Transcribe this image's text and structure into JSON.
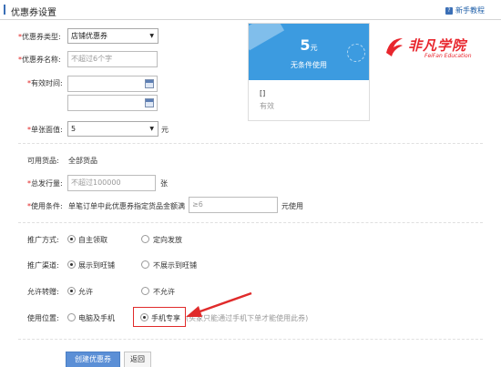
{
  "header": {
    "title": "优惠券设置",
    "help_label": "新手教程"
  },
  "form": {
    "type": {
      "label": "优惠券类型:",
      "value": "店铺优惠券"
    },
    "name": {
      "label": "优惠券名称:",
      "placeholder": "不超过6个字"
    },
    "period": {
      "label": "有效时间:"
    },
    "face_value": {
      "label": "单张面值:",
      "value": "5",
      "unit": "元"
    },
    "goods": {
      "label": "可用货品:",
      "value": "全部货品"
    },
    "quantity": {
      "label": "总发行量:",
      "placeholder": "不超过100000",
      "unit": "张"
    },
    "condition": {
      "label": "使用条件:",
      "text": "单笔订单中此优惠券指定货品金额满",
      "placeholder": "≥6",
      "unit": "元使用"
    },
    "promotion_method": {
      "label": "推广方式:",
      "options": [
        "自主领取",
        "定向发放"
      ],
      "selected": 0
    },
    "promotion_channel": {
      "label": "推广渠道:",
      "options": [
        "展示到旺铺",
        "不展示到旺铺"
      ],
      "selected": 0
    },
    "transfer": {
      "label": "允许转赠:",
      "options": [
        "允许",
        "不允许"
      ],
      "selected": 0
    },
    "usage_location": {
      "label": "使用位置:",
      "options": [
        "电脑及手机",
        "手机专享"
      ],
      "selected": 1,
      "note": "(买家只能通过手机下单才能使用此券)"
    }
  },
  "buttons": {
    "create": "创建优惠券",
    "back": "返回"
  },
  "preview": {
    "amount": "5",
    "amount_unit": "元",
    "condition": "无条件使用",
    "bracket": "[]",
    "status": "有效"
  },
  "logo": {
    "name": "非凡学院",
    "en": "FeiFan Education"
  },
  "colors": {
    "accent": "#3b6fb6",
    "coupon_blue": "#3c9be0",
    "required_star": "#e02020",
    "arrow_red": "#e02b2b",
    "logo_red": "#e8262d"
  }
}
